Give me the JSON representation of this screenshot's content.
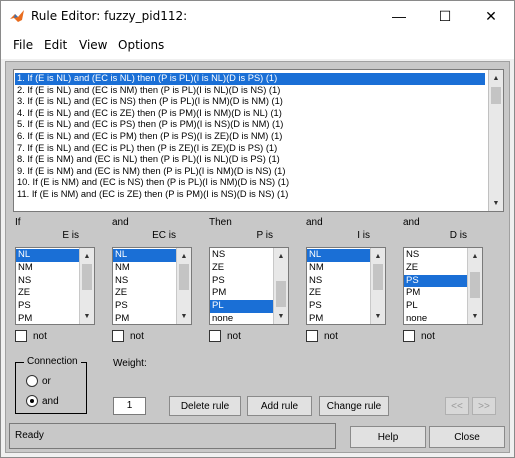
{
  "window": {
    "title": "Rule Editor: fuzzy_pid112:",
    "minimize": "—",
    "maximize": "☐",
    "close": "✕"
  },
  "menu": {
    "items": [
      "File",
      "Edit",
      "View",
      "Options"
    ]
  },
  "rules": {
    "items": [
      "1. If (E is NL) and (EC is NL) then (P is PL)(I is NL)(D is PS) (1)",
      "2. If (E is NL) and (EC is NM) then (P is PL)(I is NL)(D is NS) (1)",
      "3. If (E is NL) and (EC is NS) then (P is PL)(I is NM)(D is NM) (1)",
      "4. If (E is NL) and (EC is ZE) then (P is PM)(I is NM)(D is NL) (1)",
      "5. If (E is NL) and (EC is PS) then (P is PM)(I is NS)(D is NM) (1)",
      "6. If (E is NL) and (EC is PM) then (P is PS)(I is ZE)(D is NM) (1)",
      "7. If (E is NL) and (EC is PL) then (P is ZE)(I is ZE)(D is PS) (1)",
      "8. If (E is NM) and (EC is NL) then (P is PL)(I is NL)(D is PS) (1)",
      "9. If (E is NM) and (EC is NM) then (P is PL)(I is NM)(D is NS) (1)",
      "10. If (E is NM) and (EC is NS) then (P is PL)(I is NM)(D is NS) (1)",
      "11. If (E is NM) and (EC is ZE) then (P is PM)(I is NS)(D is NS) (1)"
    ],
    "selected_index": 0
  },
  "inputs": {
    "e": {
      "lead": "If",
      "name": "E is",
      "options": [
        "NL",
        "NM",
        "NS",
        "ZE",
        "PS",
        "PM"
      ],
      "selected": "NL",
      "not_label": "not"
    },
    "ec": {
      "lead": "and",
      "name": "EC is",
      "options": [
        "NL",
        "NM",
        "NS",
        "ZE",
        "PS",
        "PM"
      ],
      "selected": "NL",
      "not_label": "not"
    }
  },
  "outputs": {
    "p": {
      "lead": "Then",
      "name": "P is",
      "options": [
        "NS",
        "ZE",
        "PS",
        "PM",
        "PL",
        "none"
      ],
      "selected": "PL",
      "not_label": "not"
    },
    "i": {
      "lead": "and",
      "name": "I is",
      "options": [
        "NL",
        "NM",
        "NS",
        "ZE",
        "PS",
        "PM"
      ],
      "selected": "NL",
      "not_label": "not"
    },
    "d": {
      "lead": "and",
      "name": "D is",
      "options": [
        "NS",
        "ZE",
        "PS",
        "PM",
        "PL",
        "none"
      ],
      "selected": "PS",
      "not_label": "not"
    }
  },
  "connection": {
    "label": "Connection",
    "options": [
      "or",
      "and"
    ],
    "selected": "and"
  },
  "weight": {
    "label": "Weight:",
    "value": "1"
  },
  "buttons": {
    "delete_rule": "Delete rule",
    "add_rule": "Add rule",
    "change_rule": "Change rule",
    "prev": "<<",
    "next": ">>",
    "help": "Help",
    "close": "Close"
  },
  "status": {
    "text": "Ready"
  },
  "colors": {
    "selection": "#1a6fd6",
    "panel": "#c8c8c8"
  }
}
